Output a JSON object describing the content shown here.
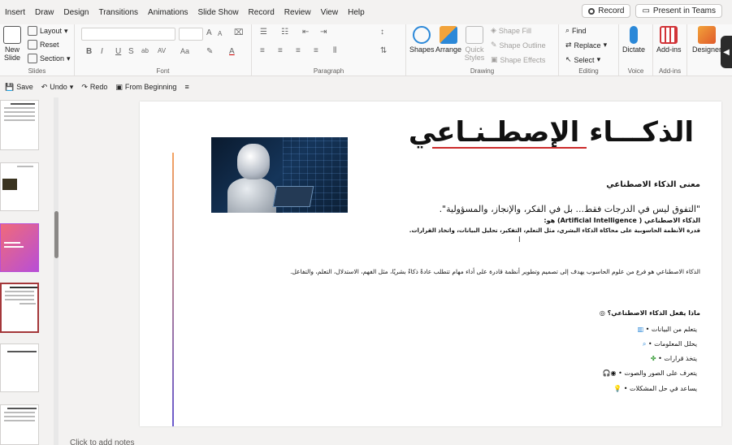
{
  "menu": {
    "tabs": [
      "Insert",
      "Draw",
      "Design",
      "Transitions",
      "Animations",
      "Slide Show",
      "Record",
      "Review",
      "View",
      "Help"
    ],
    "record_button": "Record",
    "present_button": "Present in Teams"
  },
  "ribbon": {
    "slides": {
      "label": "Slides",
      "new_slide": "New",
      "new_slide_sub": "Slide",
      "layout": "Layout",
      "reset": "Reset",
      "section": "Section"
    },
    "font": {
      "label": "Font",
      "size_up": "A",
      "size_down": "A",
      "case": "Aa",
      "bold": "B",
      "italic": "I",
      "underline": "U",
      "strike": "S",
      "shadow": "ab",
      "spacing": "AV"
    },
    "paragraph": {
      "label": "Paragraph"
    },
    "drawing": {
      "label": "Drawing",
      "shapes": "Shapes",
      "arrange": "Arrange",
      "quick_styles": "Quick Styles",
      "shape_fill": "Shape Fill",
      "shape_outline": "Shape Outline",
      "shape_effects": "Shape Effects"
    },
    "editing": {
      "label": "Editing",
      "find": "Find",
      "replace": "Replace",
      "select": "Select"
    },
    "voice": {
      "label": "Voice",
      "dictate": "Dictate"
    },
    "addins": {
      "label": "Add-ins",
      "addins": "Add-ins"
    },
    "designer": {
      "label": "Designer"
    }
  },
  "qat": {
    "save": "Save",
    "undo": "Undo",
    "redo": "Redo",
    "from_beginning": "From Beginning"
  },
  "slide": {
    "title": "الذكـــاء الإصطـنـاعي",
    "heading": "معنى الذكاء الاصطناعي",
    "quote": "\"التفوق ليس في الدرجات فقط... بل في الفكر، والإنجاز، والمسؤولية\".",
    "bold_line1": "الذكاء الاصطناعي ( Artificial Intelligence) هو:",
    "bold_line2": "قدرة الأنظمة الحاسوبية على محاكاة الذكاء البشري، مثل التعلم، التفكير، تحليل البيانات، واتخاذ القرارات.",
    "paragraph": "الذكاء الاصطناعي هو فرع من علوم الحاسوب يهدف إلى تصميم وتطوير أنظمة قادرة على أداء مهام تتطلب عادةً ذكاءً بشريًا، مثل الفهم، الاستدلال، التعلم، والتفاعل.",
    "question": "ماذا يفعل الذكاء الاصطناعي؟",
    "bullets": [
      "يتعلم من البيانات •",
      "يحلل المعلومات •",
      "يتخذ قرارات •",
      "يتعرف على الصور والصوت •",
      "يساعد في حل المشكلات •"
    ]
  },
  "notes_placeholder": "Click to add notes"
}
